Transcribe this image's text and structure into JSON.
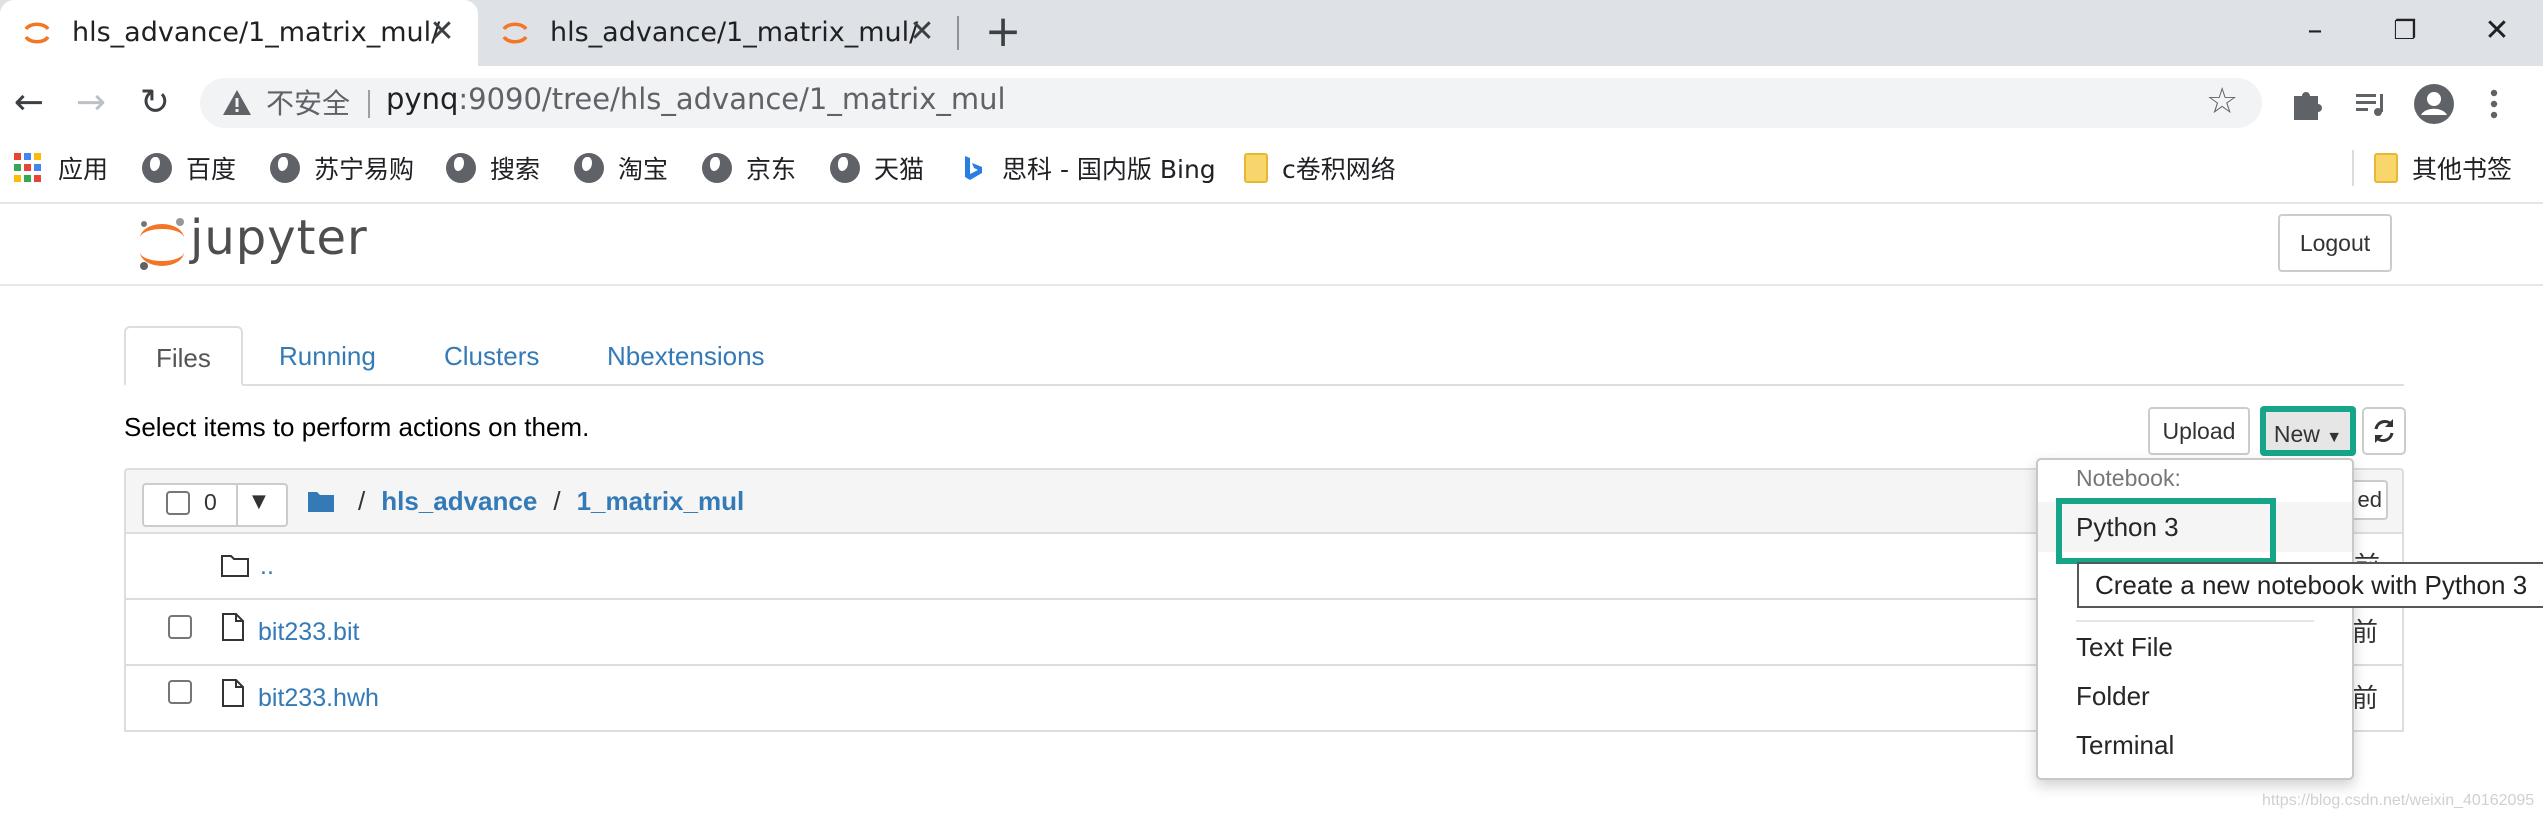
{
  "browser": {
    "tabs": [
      {
        "title": "hls_advance/1_matrix_mul/",
        "active": true
      },
      {
        "title": "hls_advance/1_matrix_mul/",
        "active": false
      }
    ],
    "new_tab_symbol": "+",
    "window_controls": {
      "minimize": "–",
      "restore": "❐",
      "close": "✕"
    }
  },
  "toolbar": {
    "security_label": "不安全",
    "url_host": "pynq",
    "url_rest": ":9090/tree/hls_advance/1_matrix_mul",
    "icons": [
      "back-icon",
      "forward-icon",
      "reload-icon",
      "star-icon",
      "extensions-icon",
      "media-icon",
      "profile-icon",
      "menu-icon"
    ]
  },
  "bookmarks": {
    "items": [
      {
        "label": "应用",
        "icon": "apps-grid-icon"
      },
      {
        "label": "百度",
        "icon": "globe-icon"
      },
      {
        "label": "苏宁易购",
        "icon": "globe-icon"
      },
      {
        "label": "搜索",
        "icon": "globe-icon"
      },
      {
        "label": "淘宝",
        "icon": "globe-icon"
      },
      {
        "label": "京东",
        "icon": "globe-icon"
      },
      {
        "label": "天猫",
        "icon": "globe-icon"
      },
      {
        "label": "思科 - 国内版 Bing",
        "icon": "bing-icon"
      },
      {
        "label": "c卷积网络",
        "icon": "folder-icon"
      }
    ],
    "other": {
      "label": "其他书签",
      "icon": "folder-icon"
    }
  },
  "jupyter": {
    "logo_text": "jupyter",
    "logout_label": "Logout",
    "tabs": [
      "Files",
      "Running",
      "Clusters",
      "Nbextensions"
    ],
    "select_hint": "Select items to perform actions on them.",
    "upload_label": "Upload",
    "new_label": "New",
    "selected_count": "0",
    "breadcrumb": [
      "hls_advance",
      "1_matrix_mul"
    ],
    "files": [
      {
        "name": "..",
        "type": "folder",
        "modified": ""
      },
      {
        "name": "bit233.bit",
        "type": "file",
        "modified": "前"
      },
      {
        "name": "bit233.hwh",
        "type": "file",
        "modified": "前"
      }
    ],
    "partial_header_button": "ed",
    "partial_up_time": "前"
  },
  "new_menu": {
    "header": "Notebook:",
    "items": [
      "Python 3",
      "Text File",
      "Folder",
      "Terminal"
    ],
    "tooltip": "Create a new notebook with Python 3"
  },
  "colors": {
    "highlight": "#17a589",
    "link": "#337ab7",
    "jupyter_orange": "#f37626"
  },
  "watermark": "https://blog.csdn.net/weixin_40162095"
}
